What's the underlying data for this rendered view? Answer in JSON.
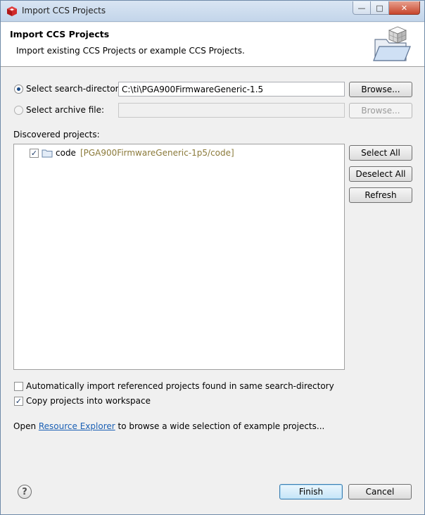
{
  "window": {
    "title": "Import CCS Projects",
    "controls": {
      "minimize": "—",
      "maximize": "□",
      "close": "✕"
    }
  },
  "header": {
    "title": "Import CCS Projects",
    "description": "Import existing CCS Projects or example CCS Projects."
  },
  "source": {
    "search_directory_label": "Select search-directory:",
    "search_directory_value": "C:\\ti\\PGA900FirmwareGeneric-1.5",
    "archive_file_label": "Select archive file:",
    "archive_file_value": "",
    "browse_label": "Browse...",
    "browse_disabled_label": "Browse..."
  },
  "discovered": {
    "label": "Discovered projects:",
    "projects": [
      {
        "name": "code",
        "path": "[PGA900FirmwareGeneric-1p5/code]",
        "checked": true
      }
    ],
    "select_all": "Select All",
    "deselect_all": "Deselect All",
    "refresh": "Refresh"
  },
  "options": {
    "auto_import_label": "Automatically import referenced projects found in same search-directory",
    "auto_import_checked": false,
    "copy_projects_label": "Copy projects into workspace",
    "copy_projects_checked": true
  },
  "footer_text": {
    "prefix": "Open ",
    "link": "Resource Explorer",
    "suffix": " to browse a wide selection of example projects..."
  },
  "buttons": {
    "help": "?",
    "finish": "Finish",
    "cancel": "Cancel"
  },
  "colors": {
    "accent": "#1b4a86",
    "link": "#1a5fb4",
    "project_path": "#8b7a3a"
  }
}
